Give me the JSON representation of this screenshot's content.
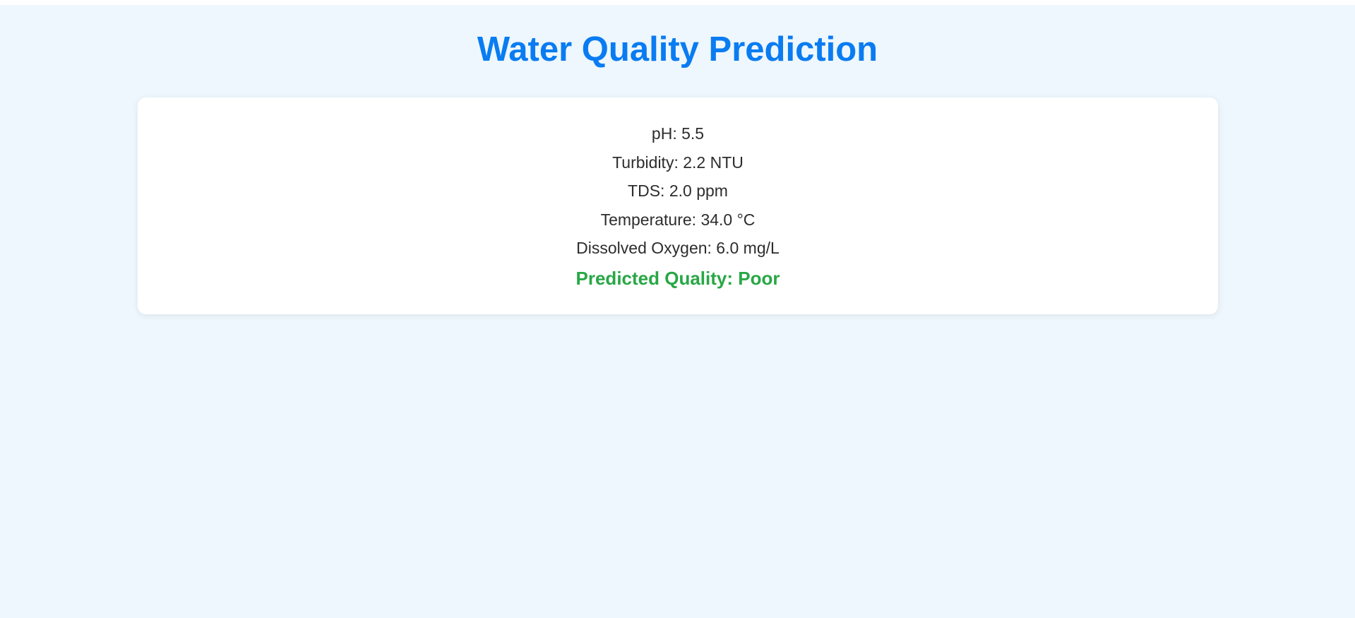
{
  "page": {
    "title": "Water Quality Prediction",
    "background_color": "#eef7fd",
    "title_color": "#0a7cf2"
  },
  "readings": [
    "pH: 5.5",
    "Turbidity: 2.2 NTU",
    "TDS: 2.0 ppm",
    "Temperature: 34.0 °C",
    "Dissolved Oxygen: 6.0 mg/L"
  ],
  "prediction": {
    "text": "Predicted Quality: Poor",
    "color": "#28a745"
  }
}
